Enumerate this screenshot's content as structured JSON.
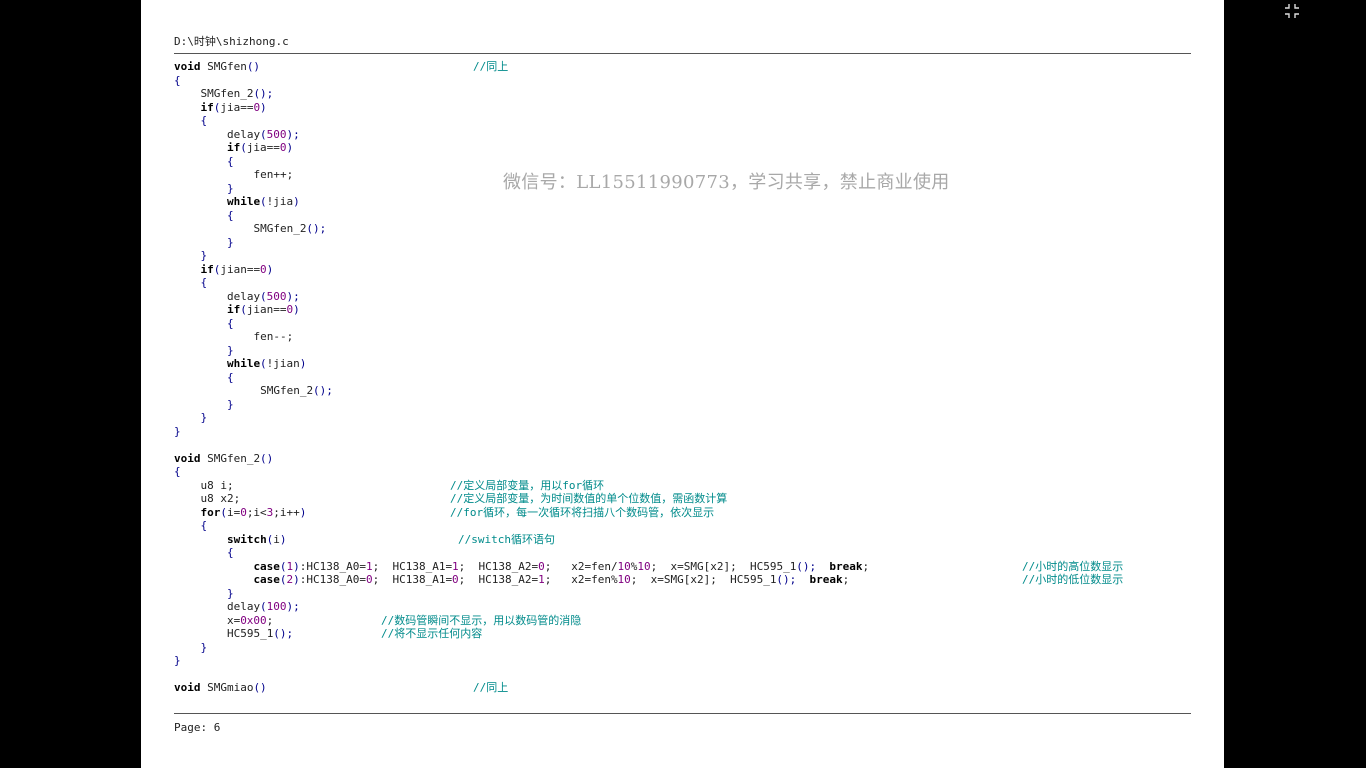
{
  "document": {
    "path": "D:\\时钟\\shizhong.c",
    "footer": "Page: 6",
    "watermark": "微信号：LL15511990773，学习共享，禁止商业使用"
  },
  "viewer": {
    "exit_fullscreen_icon": "exit-fullscreen-icon"
  },
  "code_lines": [
    [
      [
        "void",
        "kw"
      ],
      [
        " SMGfen",
        ""
      ],
      [
        "()",
        "pn"
      ],
      [
        "",
        ""
      ],
      [
        "//同上",
        "cm",
        299
      ]
    ],
    [
      [
        "{",
        "pn"
      ]
    ],
    [
      [
        "    SMGfen_2",
        ""
      ],
      [
        "();",
        "pn"
      ]
    ],
    [
      [
        "    ",
        ""
      ],
      [
        "if",
        "kw"
      ],
      [
        "(",
        "pn"
      ],
      [
        "jia==",
        ""
      ],
      [
        "0",
        "num"
      ],
      [
        ")",
        "pn"
      ]
    ],
    [
      [
        "    ",
        ""
      ],
      [
        "{",
        "pn"
      ]
    ],
    [
      [
        "        delay",
        ""
      ],
      [
        "(",
        "pn"
      ],
      [
        "500",
        "num"
      ],
      [
        ");",
        "pn"
      ]
    ],
    [
      [
        "        ",
        ""
      ],
      [
        "if",
        "kw"
      ],
      [
        "(",
        "pn"
      ],
      [
        "jia==",
        ""
      ],
      [
        "0",
        "num"
      ],
      [
        ")",
        "pn"
      ]
    ],
    [
      [
        "        ",
        ""
      ],
      [
        "{",
        "pn"
      ]
    ],
    [
      [
        "            fen++;",
        ""
      ]
    ],
    [
      [
        "        ",
        ""
      ],
      [
        "}",
        "pn"
      ]
    ],
    [
      [
        "        ",
        ""
      ],
      [
        "while",
        "kw"
      ],
      [
        "(",
        "pn"
      ],
      [
        "!jia",
        ""
      ],
      [
        ")",
        "pn"
      ]
    ],
    [
      [
        "        ",
        ""
      ],
      [
        "{",
        "pn"
      ]
    ],
    [
      [
        "            SMGfen_2",
        ""
      ],
      [
        "();",
        "pn"
      ]
    ],
    [
      [
        "        ",
        ""
      ],
      [
        "}",
        "pn"
      ]
    ],
    [
      [
        "    ",
        ""
      ],
      [
        "}",
        "pn"
      ]
    ],
    [
      [
        "    ",
        ""
      ],
      [
        "if",
        "kw"
      ],
      [
        "(",
        "pn"
      ],
      [
        "jian==",
        ""
      ],
      [
        "0",
        "num"
      ],
      [
        ")",
        "pn"
      ]
    ],
    [
      [
        "    ",
        ""
      ],
      [
        "{",
        "pn"
      ]
    ],
    [
      [
        "        delay",
        ""
      ],
      [
        "(",
        "pn"
      ],
      [
        "500",
        "num"
      ],
      [
        ");",
        "pn"
      ]
    ],
    [
      [
        "        ",
        ""
      ],
      [
        "if",
        "kw"
      ],
      [
        "(",
        "pn"
      ],
      [
        "jian==",
        ""
      ],
      [
        "0",
        "num"
      ],
      [
        ")",
        "pn"
      ]
    ],
    [
      [
        "        ",
        ""
      ],
      [
        "{",
        "pn"
      ]
    ],
    [
      [
        "            fen--;",
        ""
      ]
    ],
    [
      [
        "        ",
        ""
      ],
      [
        "}",
        "pn"
      ]
    ],
    [
      [
        "        ",
        ""
      ],
      [
        "while",
        "kw"
      ],
      [
        "(",
        "pn"
      ],
      [
        "!jian",
        ""
      ],
      [
        ")",
        "pn"
      ]
    ],
    [
      [
        "        ",
        ""
      ],
      [
        "{",
        "pn"
      ]
    ],
    [
      [
        "             SMGfen_2",
        ""
      ],
      [
        "();",
        "pn"
      ]
    ],
    [
      [
        "        ",
        ""
      ],
      [
        "}",
        "pn"
      ]
    ],
    [
      [
        "    ",
        ""
      ],
      [
        "}",
        "pn"
      ]
    ],
    [
      [
        "}",
        "pn"
      ]
    ],
    [
      [
        "",
        ""
      ]
    ],
    [
      [
        "void",
        "kw"
      ],
      [
        " SMGfen_2",
        ""
      ],
      [
        "()",
        "pn"
      ]
    ],
    [
      [
        "{",
        "pn"
      ]
    ],
    [
      [
        "    u8 i;",
        ""
      ],
      [
        "//定义局部变量，用以for循环",
        "cm",
        276
      ]
    ],
    [
      [
        "    u8 x2;",
        ""
      ],
      [
        "//定义局部变量，为时间数值的单个位数值，需函数计算",
        "cm",
        276
      ]
    ],
    [
      [
        "    ",
        ""
      ],
      [
        "for",
        "kw"
      ],
      [
        "(",
        "pn"
      ],
      [
        "i=",
        ""
      ],
      [
        "0",
        "num"
      ],
      [
        ";i<",
        ""
      ],
      [
        "3",
        "num"
      ],
      [
        ";i++",
        ""
      ],
      [
        ")",
        "pn"
      ],
      [
        "//for循环，每一次循环将扫描八个数码管，依次显示",
        "cm",
        276
      ]
    ],
    [
      [
        "    ",
        ""
      ],
      [
        "{",
        "pn"
      ]
    ],
    [
      [
        "        ",
        ""
      ],
      [
        "switch",
        "kw"
      ],
      [
        "(",
        "pn"
      ],
      [
        "i",
        ""
      ],
      [
        ")",
        "pn"
      ],
      [
        "//switch循环语句",
        "cm",
        284
      ]
    ],
    [
      [
        "        ",
        ""
      ],
      [
        "{",
        "pn"
      ]
    ],
    [
      [
        "            ",
        ""
      ],
      [
        "case",
        "kw"
      ],
      [
        "(",
        "pn"
      ],
      [
        "1",
        "num"
      ],
      [
        ")",
        "pn"
      ],
      [
        ":HC138_A0=",
        ""
      ],
      [
        "1",
        "num"
      ],
      [
        ";  HC138_A1=",
        ""
      ],
      [
        "1",
        "num"
      ],
      [
        ";  HC138_A2=",
        ""
      ],
      [
        "0",
        "num"
      ],
      [
        ";   x2=fen/",
        ""
      ],
      [
        "10",
        "num"
      ],
      [
        "%",
        ""
      ],
      [
        "10",
        "num"
      ],
      [
        ";  x=SMG[x2];  HC595_1",
        ""
      ],
      [
        "();",
        "pn"
      ],
      [
        "  ",
        ""
      ],
      [
        "break",
        "kw"
      ],
      [
        ";",
        ""
      ],
      [
        "//小时的高位数显示",
        "cm",
        848
      ]
    ],
    [
      [
        "            ",
        ""
      ],
      [
        "case",
        "kw"
      ],
      [
        "(",
        "pn"
      ],
      [
        "2",
        "num"
      ],
      [
        ")",
        "pn"
      ],
      [
        ":HC138_A0=",
        ""
      ],
      [
        "0",
        "num"
      ],
      [
        ";  HC138_A1=",
        ""
      ],
      [
        "0",
        "num"
      ],
      [
        ";  HC138_A2=",
        ""
      ],
      [
        "1",
        "num"
      ],
      [
        ";   x2=fen%",
        ""
      ],
      [
        "10",
        "num"
      ],
      [
        ";  x=SMG[x2];  HC595_1",
        ""
      ],
      [
        "();",
        "pn"
      ],
      [
        "  ",
        ""
      ],
      [
        "break",
        "kw"
      ],
      [
        ";",
        ""
      ],
      [
        "//小时的低位数显示",
        "cm",
        848
      ]
    ],
    [
      [
        "        ",
        ""
      ],
      [
        "}",
        "pn"
      ]
    ],
    [
      [
        "        delay",
        ""
      ],
      [
        "(",
        "pn"
      ],
      [
        "100",
        "num"
      ],
      [
        ");",
        "pn"
      ]
    ],
    [
      [
        "        x=",
        ""
      ],
      [
        "0x00",
        "num"
      ],
      [
        ";",
        ""
      ],
      [
        "//数码管瞬间不显示，用以数码管的消隐",
        "cm",
        207
      ]
    ],
    [
      [
        "        HC595_1",
        ""
      ],
      [
        "();",
        "pn"
      ],
      [
        "//将不显示任何内容",
        "cm",
        207
      ]
    ],
    [
      [
        "    ",
        ""
      ],
      [
        "}",
        "pn"
      ]
    ],
    [
      [
        "}",
        "pn"
      ]
    ],
    [
      [
        "",
        ""
      ]
    ],
    [
      [
        "void",
        "kw"
      ],
      [
        " SMGmiao",
        ""
      ],
      [
        "()",
        "pn"
      ],
      [
        "//同上",
        "cm",
        299
      ]
    ]
  ]
}
